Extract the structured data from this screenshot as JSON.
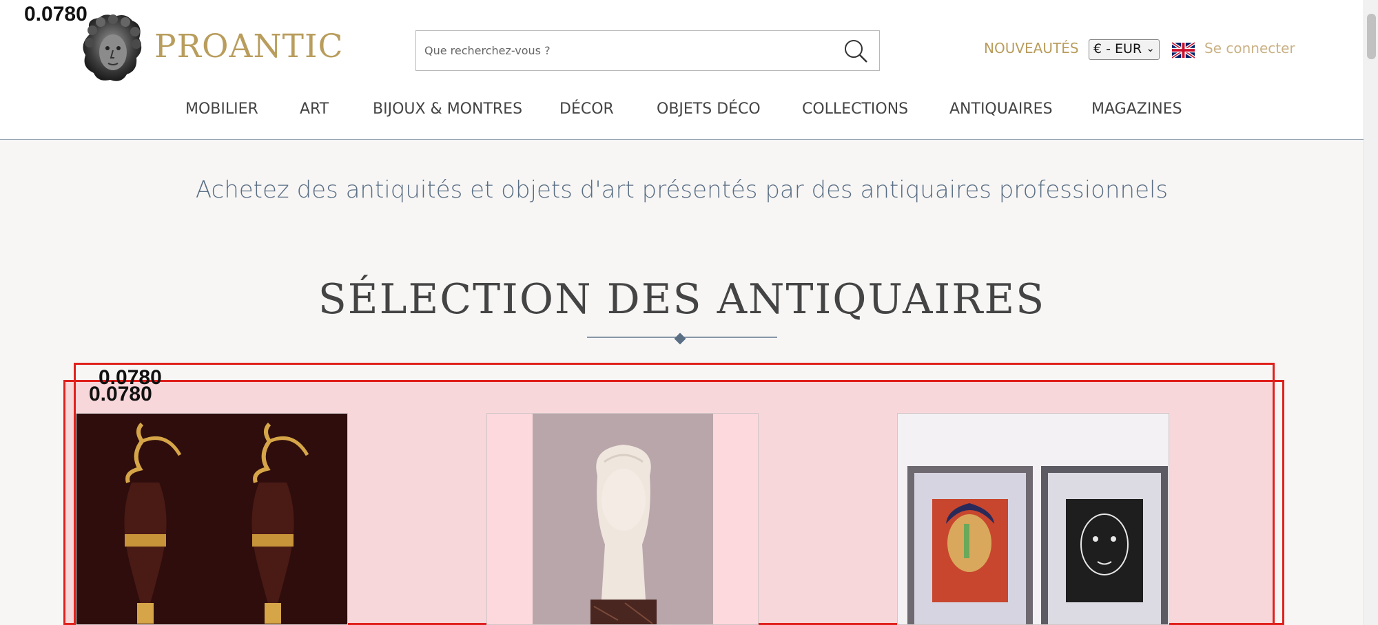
{
  "overlay_scores": [
    "0.0780",
    "0.0780",
    "0.0780"
  ],
  "brand": {
    "name": "PROANTIC",
    "logo_icon": "greek-head-logo-icon",
    "gold_color": "#b99d5d"
  },
  "search": {
    "placeholder": "Que recherchez-vous ?",
    "icon": "search-icon"
  },
  "header": {
    "nouveautes": "NOUVEAUTÉS",
    "currency": "€ - EUR",
    "currency_caret": "⌄",
    "flag_icon": "uk-flag-icon",
    "login": "Se connecter"
  },
  "nav": {
    "items": [
      {
        "label": "MOBILIER"
      },
      {
        "label": "ART"
      },
      {
        "label": "BIJOUX & MONTRES"
      },
      {
        "label": "DÉCOR"
      },
      {
        "label": "OBJETS DÉCO"
      },
      {
        "label": "COLLECTIONS"
      },
      {
        "label": "ANTIQUAIRES"
      },
      {
        "label": "MAGAZINES"
      }
    ]
  },
  "main": {
    "tagline": "Achetez des antiquités et objets d'art présentés par des antiquaires professionnels",
    "section_title": "SÉLECTION DES ANTIQUAIRES",
    "title_color": "#5a6e84"
  },
  "products": [
    {
      "image": "bronze-ewers-pair-image"
    },
    {
      "image": "marble-bust-image"
    },
    {
      "image": "framed-portraits-image"
    }
  ],
  "highlight_color": "#e0201c"
}
